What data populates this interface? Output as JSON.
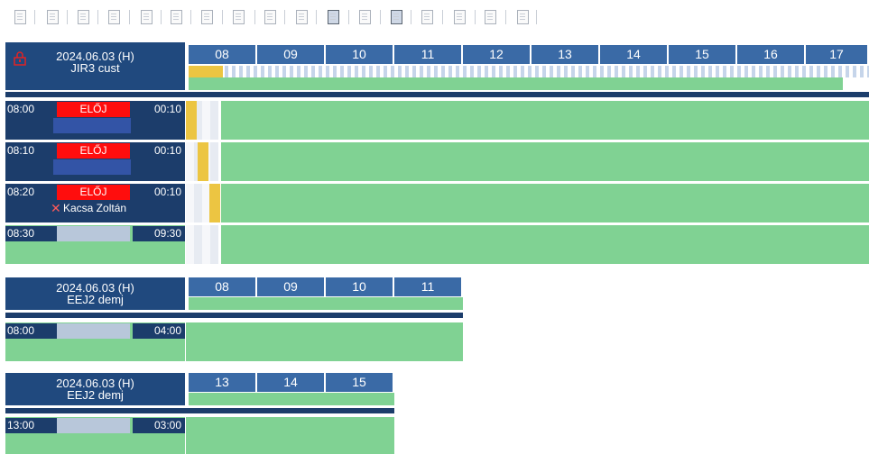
{
  "toolbar": {
    "icons": [
      "doc-edit-icon",
      "doc-check-icon",
      "doc-copy-icon",
      "doc-insert-icon",
      "doc-edit2-icon",
      "doc-add-icon",
      "doc-move-icon",
      "doc-move2-icon",
      "doc-plus-icon",
      "doc-check2-icon",
      "doc-split-icon",
      "pdf-icon",
      "print-icon",
      "pdf2-icon",
      "pdf3-icon",
      "pdf4-icon",
      "doc-note-icon"
    ]
  },
  "blocks": [
    {
      "date": "2024.06.03 (H)",
      "resource": "JIR3 cust",
      "hours": [
        "08",
        "09",
        "10",
        "11",
        "12",
        "13",
        "14",
        "15",
        "16",
        "17"
      ],
      "rows": [
        {
          "start": "08:00",
          "status": "ELŐJ",
          "end": "00:10",
          "sub": ""
        },
        {
          "start": "08:10",
          "status": "ELŐJ",
          "end": "00:10",
          "sub": ""
        },
        {
          "start": "08:20",
          "status": "ELŐJ",
          "end": "00:10",
          "sub": "Kacsa Zoltán"
        },
        {
          "start": "08:30",
          "status": "",
          "end": "09:30",
          "sub": ""
        }
      ]
    },
    {
      "date": "2024.06.03 (H)",
      "resource": "EEJ2 demj",
      "hours": [
        "08",
        "09",
        "10",
        "11"
      ],
      "rows": [
        {
          "start": "08:00",
          "status": "",
          "end": "04:00",
          "sub": ""
        }
      ]
    },
    {
      "date": "2024.06.03 (H)",
      "resource": "EEJ2 demj",
      "hours": [
        "13",
        "14",
        "15"
      ],
      "rows": [
        {
          "start": "13:00",
          "status": "",
          "end": "03:00",
          "sub": ""
        }
      ]
    }
  ],
  "colors": {
    "header": "#20497e",
    "hour": "#3a6aa6",
    "green": "#80d293",
    "status": "#ff0d0d",
    "marker": "#ecc542"
  }
}
